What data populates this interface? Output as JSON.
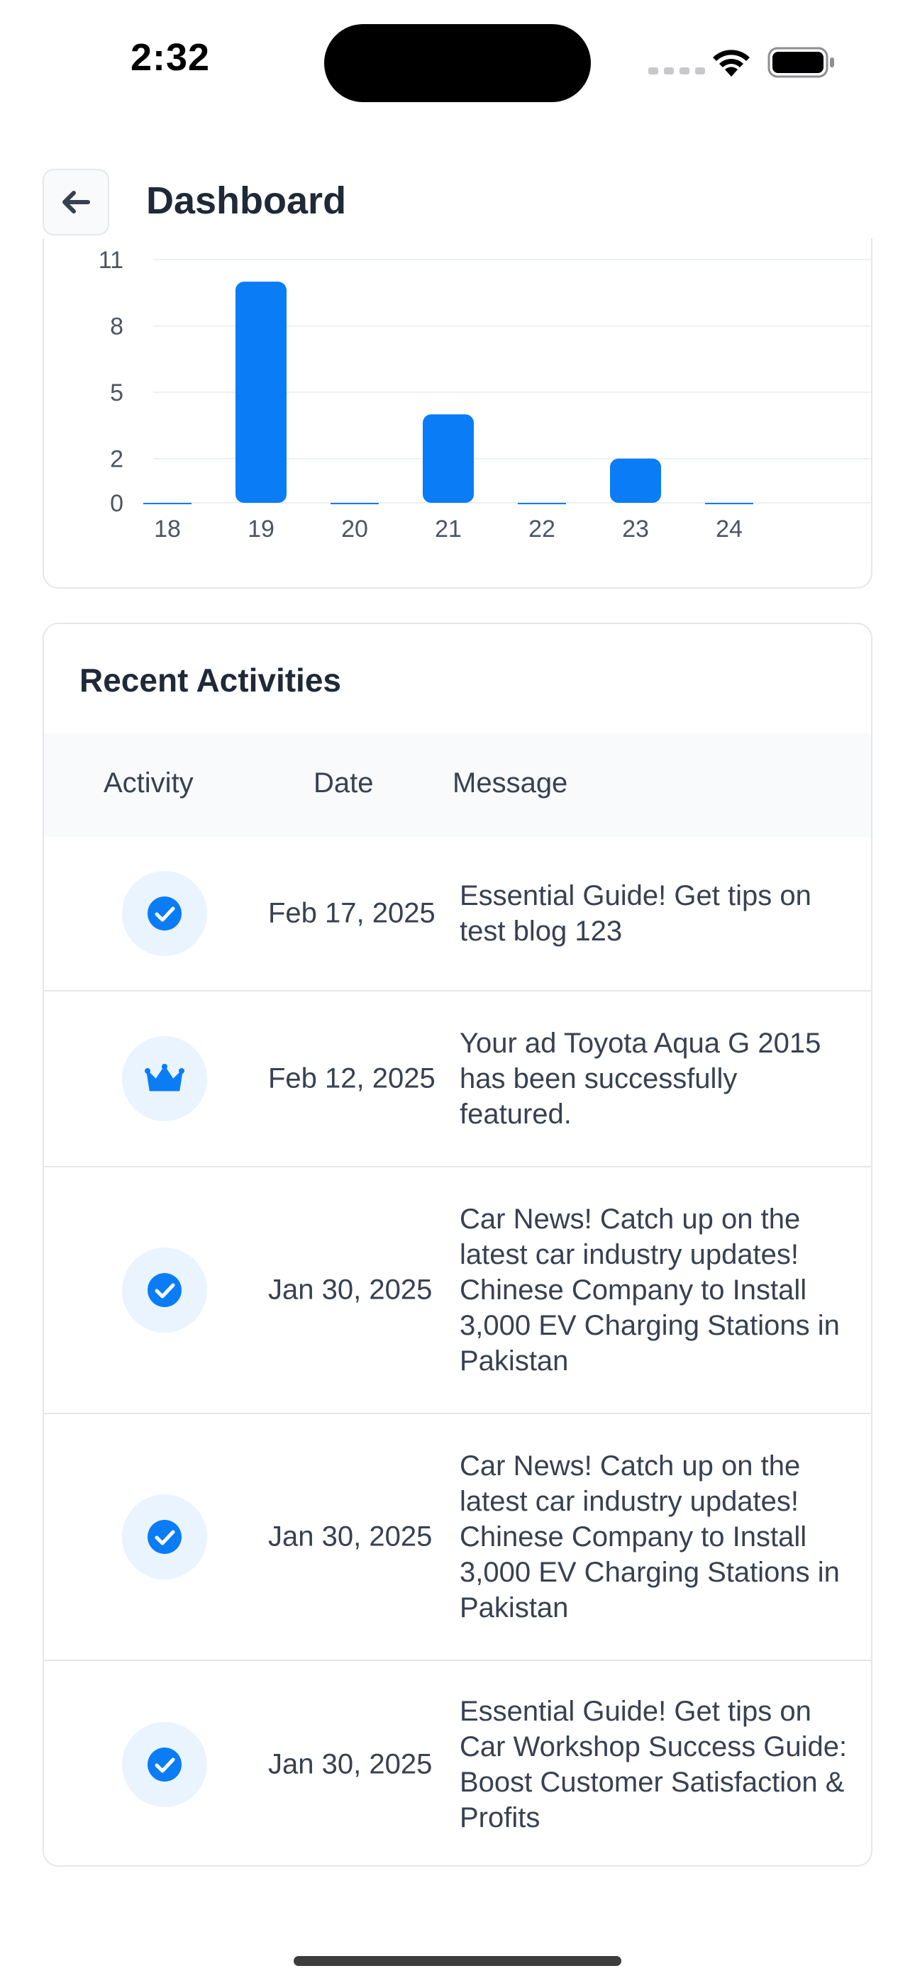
{
  "status_bar": {
    "time": "2:32"
  },
  "header": {
    "back_icon": "arrow-left-icon",
    "title": "Dashboard"
  },
  "chart_data": {
    "type": "bar",
    "categories": [
      "18",
      "19",
      "20",
      "21",
      "22",
      "23",
      "24"
    ],
    "values": [
      0,
      10,
      0,
      4,
      0,
      2,
      0
    ],
    "yticks": [
      0,
      2,
      5,
      8,
      11
    ],
    "ylim": [
      0,
      11
    ],
    "grid": true,
    "bar_color": "#0a7cf6"
  },
  "activities": {
    "title": "Recent Activities",
    "columns": [
      "Activity",
      "Date",
      "Message"
    ],
    "rows": [
      {
        "icon": "check-circle-icon",
        "date": "Feb 17, 2025",
        "message": "Essential Guide! Get tips on test blog 123"
      },
      {
        "icon": "crown-icon",
        "date": "Feb 12, 2025",
        "message": "Your ad Toyota Aqua G 2015 has been successfully featured."
      },
      {
        "icon": "check-circle-icon",
        "date": "Jan 30, 2025",
        "message": "Car News! Catch up on the latest car industry updates! Chinese Company to Install 3,000 EV Charging Stations in Pakistan"
      },
      {
        "icon": "check-circle-icon",
        "date": "Jan 30, 2025",
        "message": "Car News! Catch up on the latest car industry updates! Chinese Company to Install 3,000 EV Charging Stations in Pakistan"
      },
      {
        "icon": "check-circle-icon",
        "date": "Jan 30, 2025",
        "message": "Essential Guide! Get tips on Car Workshop Success Guide: Boost Customer Satisfaction & Profits"
      }
    ]
  },
  "colors": {
    "accent": "#0a7cf6",
    "icon_bg": "#eaf4ff"
  }
}
